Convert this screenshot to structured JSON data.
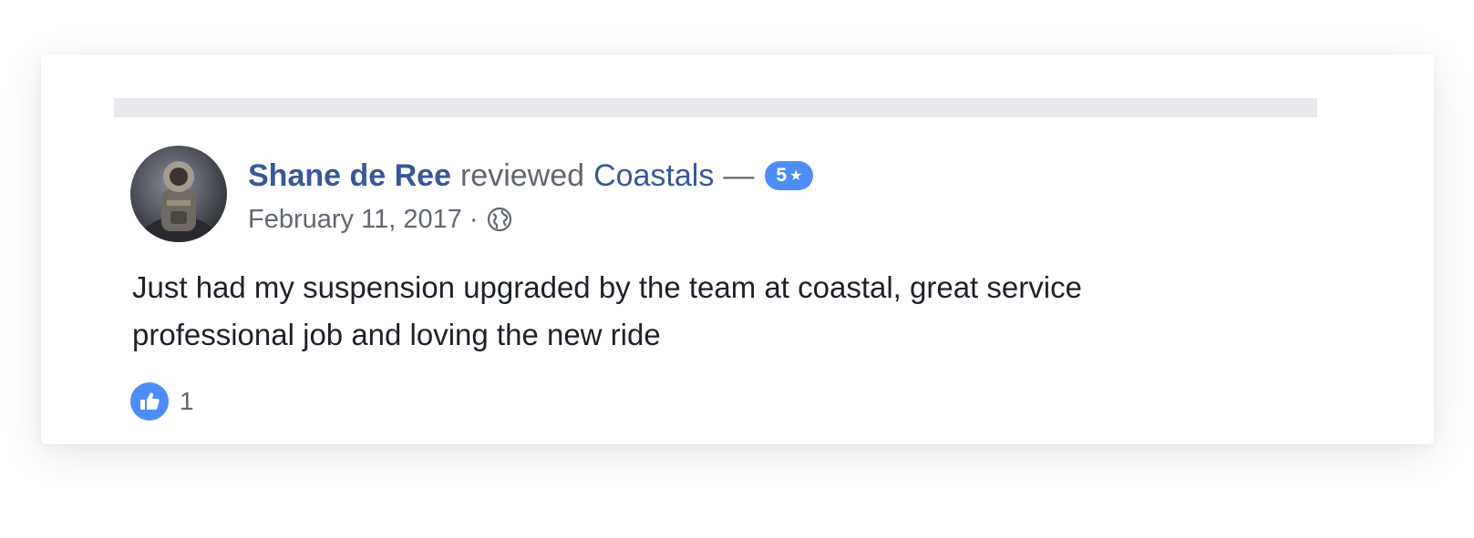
{
  "post": {
    "author": "Shane de Ree",
    "action_text": "reviewed",
    "page_name": "Coastals",
    "dash": "—",
    "rating": "5",
    "rating_star": "★",
    "date": "February 11, 2017",
    "separator": "·",
    "privacy_icon": "globe-icon",
    "review_lines": [
      "Just had my suspension upgraded by the team at coastal, great service",
      "professional job and loving the new ride"
    ],
    "reactions": {
      "icon": "like-icon",
      "count": "1"
    }
  },
  "colors": {
    "link": "#385898",
    "meta": "#606770",
    "text": "#1d2129",
    "accent": "#4d8df5",
    "divider": "#e7e9ec"
  }
}
